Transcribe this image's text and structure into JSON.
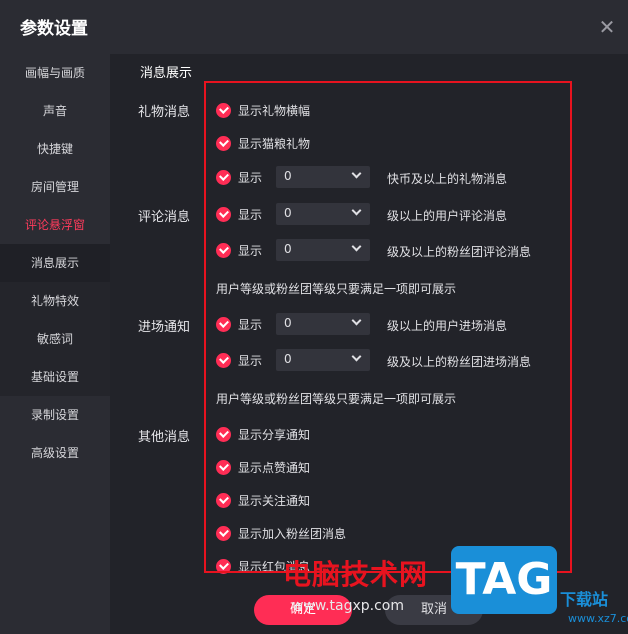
{
  "window": {
    "title": "参数设置"
  },
  "sidebar": {
    "items": [
      {
        "label": "画幅与画质"
      },
      {
        "label": "声音"
      },
      {
        "label": "快捷键"
      },
      {
        "label": "房间管理"
      },
      {
        "label": "评论悬浮窗"
      },
      {
        "label": "消息展示"
      },
      {
        "label": "礼物特效"
      },
      {
        "label": "敏感词"
      },
      {
        "label": "基础设置"
      },
      {
        "label": "录制设置"
      },
      {
        "label": "高级设置"
      }
    ]
  },
  "main": {
    "section_title": "消息展示",
    "groups": {
      "gift": "礼物消息",
      "comment": "评论消息",
      "entry": "进场通知",
      "other": "其他消息"
    },
    "gift_rows": {
      "banner": "显示礼物横幅",
      "cat_food": "显示猫粮礼物",
      "show": "显示",
      "select_value": "0",
      "suffix": "快币及以上的礼物消息"
    },
    "comment_rows": {
      "show1": "显示",
      "select1": "0",
      "suffix1": "级以上的用户评论消息",
      "show2": "显示",
      "select2": "0",
      "suffix2": "级及以上的粉丝团评论消息",
      "note": "用户等级或粉丝团等级只要满足一项即可展示"
    },
    "entry_rows": {
      "show1": "显示",
      "select1": "0",
      "suffix1": "级以上的用户进场消息",
      "show2": "显示",
      "select2": "0",
      "suffix2": "级及以上的粉丝团进场消息",
      "note": "用户等级或粉丝团等级只要满足一项即可展示"
    },
    "other_rows": {
      "share": "显示分享通知",
      "like": "显示点赞通知",
      "follow": "显示关注通知",
      "fan_join": "显示加入粉丝团消息",
      "red_packet": "显示红包消息"
    }
  },
  "footer": {
    "ok_label": "确定",
    "cancel_label": "取消"
  },
  "watermark": {
    "site_name": "电脑技术网",
    "url": "www.tagxp.com",
    "logo": "TAG",
    "sub": "下载站",
    "sub2": "www.xz7.com"
  },
  "colors": {
    "accent": "#ff2d55",
    "highlight_box": "#e8131f",
    "active_nav": "#ff3b5c"
  }
}
